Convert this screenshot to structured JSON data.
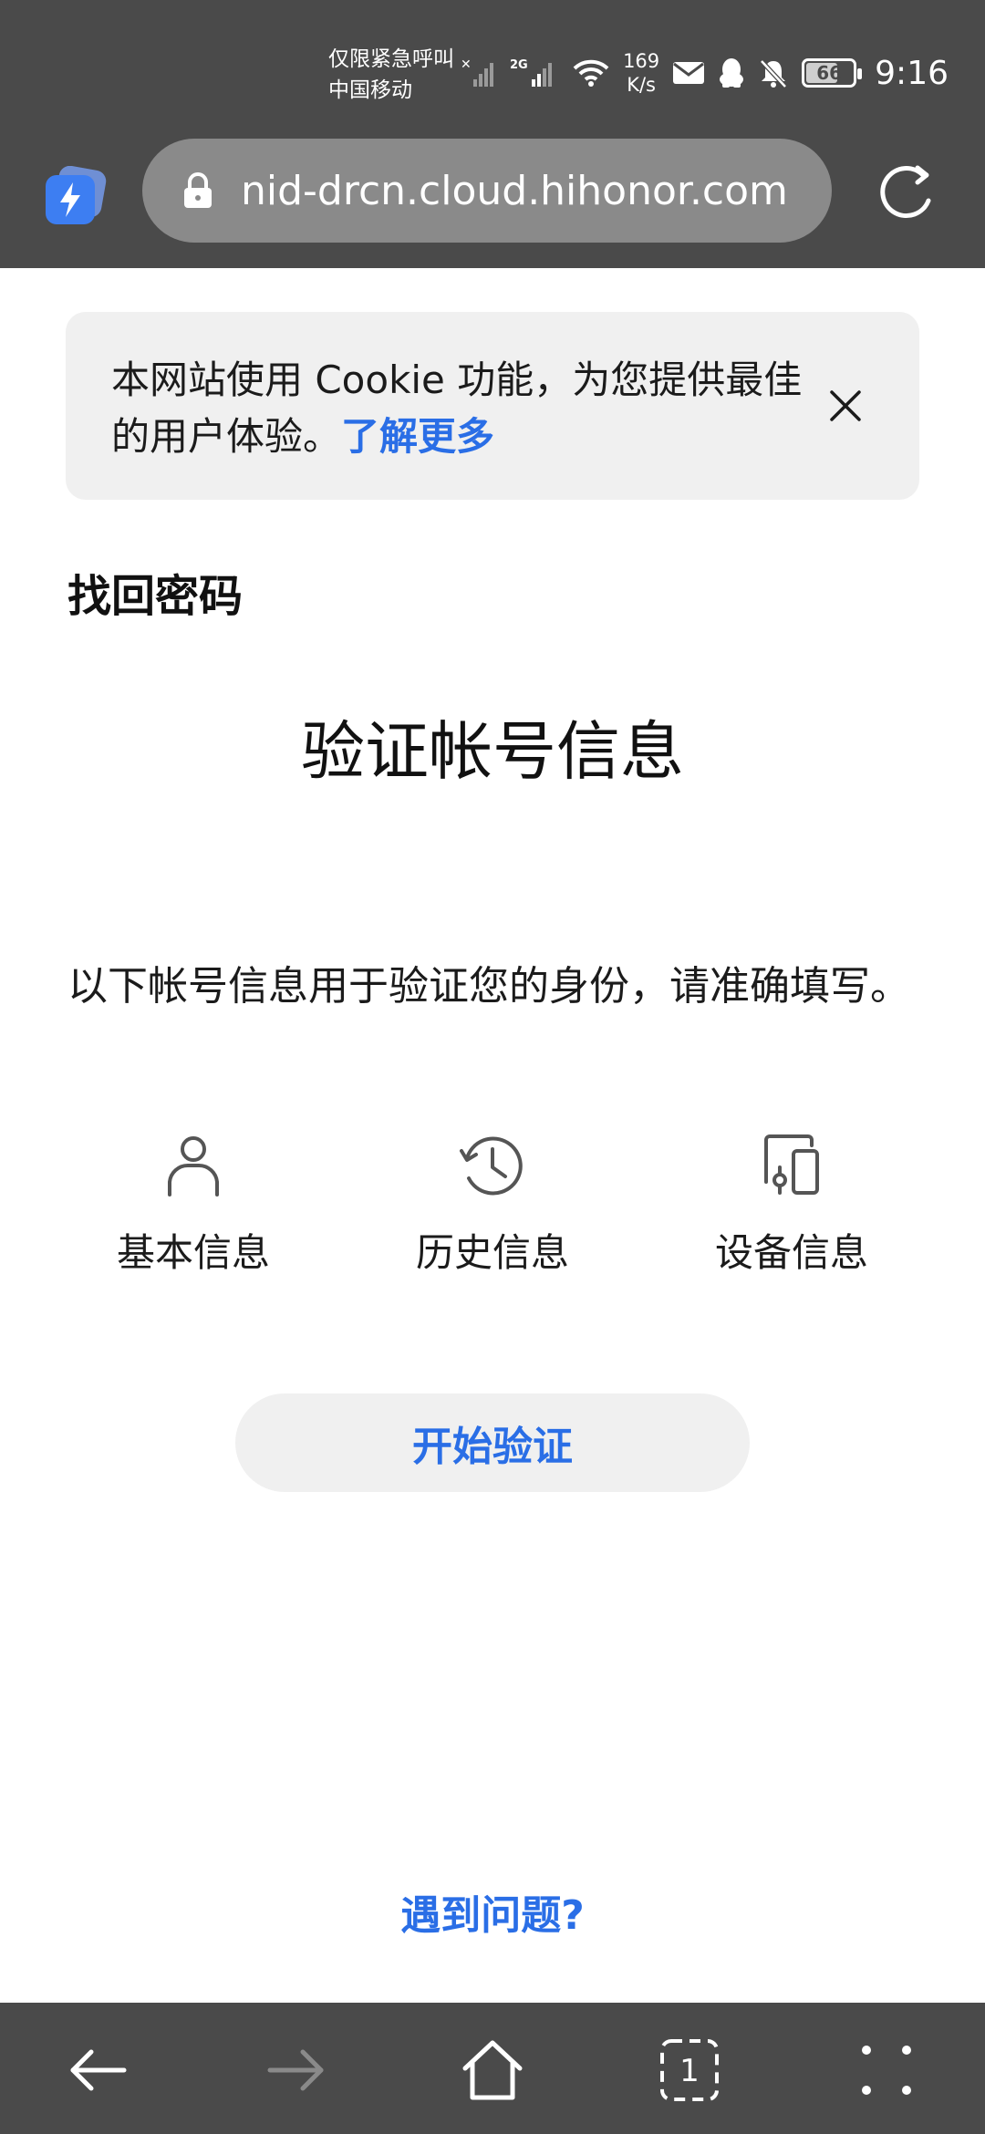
{
  "status_bar": {
    "carrier_line1": "仅限紧急呼叫",
    "carrier_line2": "中国移动",
    "net_speed_value": "169",
    "net_speed_unit": "K/s",
    "battery_level": "66",
    "time": "9:16"
  },
  "browser": {
    "url": "nid-drcn.cloud.hihonor.com"
  },
  "cookie_banner": {
    "text": "本网站使用 Cookie 功能，为您提供最佳的用户体验。",
    "link_label": "了解更多"
  },
  "page": {
    "title": "找回密码",
    "heading": "验证帐号信息",
    "description": "以下帐号信息用于验证您的身份，请准确填写。",
    "info_items": [
      {
        "label": "基本信息",
        "icon": "person-icon"
      },
      {
        "label": "历史信息",
        "icon": "history-icon"
      },
      {
        "label": "设备信息",
        "icon": "devices-icon"
      }
    ],
    "start_button": "开始验证",
    "help_link": "遇到问题?"
  },
  "bottom_nav": {
    "tab_count": "1"
  },
  "colors": {
    "accent": "#2a6ee6",
    "chrome": "#4a4a4a"
  }
}
